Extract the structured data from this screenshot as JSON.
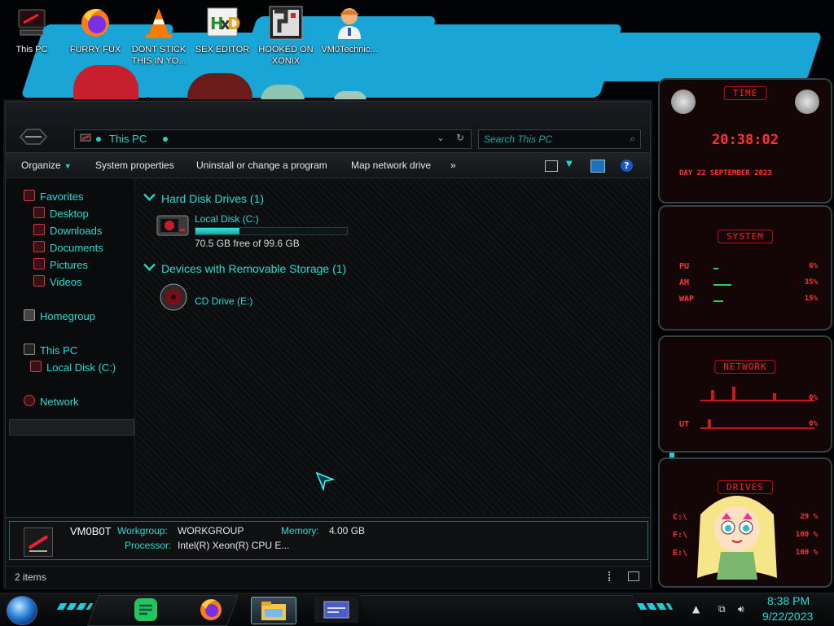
{
  "desktop": {
    "icons": [
      {
        "name": "this-pc-desktop-icon",
        "label": "This PC"
      },
      {
        "name": "firefox-desktop-icon",
        "label": "FURRY FUX"
      },
      {
        "name": "vlc-desktop-icon",
        "label": "DONT STICK THIS IN YO..."
      },
      {
        "name": "hxd-desktop-icon",
        "label": "SEX EDITOR"
      },
      {
        "name": "xonix-desktop-icon",
        "label": "HOOKED ON XONIX"
      },
      {
        "name": "vm0-desktop-icon",
        "label": "VM0Technic..."
      }
    ]
  },
  "explorer": {
    "address": "This PC",
    "search_placeholder": "Search This PC",
    "toolbar": {
      "organize": "Organize",
      "system_properties": "System properties",
      "uninstall": "Uninstall or change a program",
      "map_drive": "Map network drive",
      "more": "»"
    },
    "nav": {
      "favorites": "Favorites",
      "desktop": "Desktop",
      "downloads": "Downloads",
      "documents": "Documents",
      "pictures": "Pictures",
      "videos": "Videos",
      "homegroup": "Homegroup",
      "this_pc": "This PC",
      "local_disk": "Local Disk (C:)",
      "network": "Network"
    },
    "groups": {
      "hdd": "Hard Disk Drives (1)",
      "removable": "Devices with Removable Storage (1)"
    },
    "drives": {
      "c_name": "Local Disk (C:)",
      "c_free": "70.5 GB free of 99.6 GB",
      "c_used_fraction": 0.292,
      "e_name": "CD Drive (E:)"
    },
    "details": {
      "computer_name": "VM0B0T",
      "workgroup_label": "Workgroup:",
      "workgroup": "WORKGROUP",
      "memory_label": "Memory:",
      "memory": "4.00 GB",
      "processor_label": "Processor:",
      "processor": "Intel(R) Xeon(R) CPU E..."
    },
    "status": "2 items"
  },
  "widgets": {
    "time_title": "TIME",
    "time": "20:38:02",
    "date": "DAY 22 SEPTEMBER 2023",
    "system_title": "SYSTEM",
    "cpu_label": "PU",
    "cpu_val": "6%",
    "ram_label": "AM",
    "ram_val": "35%",
    "swap_label": "WAP",
    "swap_val": "15%",
    "network_title": "NETWORK",
    "net_in": "0%",
    "net_out_label": "UT",
    "net_out": "0%",
    "drives_title": "DRIVES",
    "d1_label": "C:\\",
    "d1_val": "29 %",
    "d2_label": "F:\\",
    "d2_val": "100 %",
    "d3_label": "E:\\",
    "d3_val": "100 %"
  },
  "taskbar": {
    "time": "8:38 PM",
    "date": "9/22/2023"
  },
  "colors": {
    "accent": "#23dcd3",
    "widget_red": "#ff2a2a",
    "brush_blue": "#19a6d6"
  }
}
